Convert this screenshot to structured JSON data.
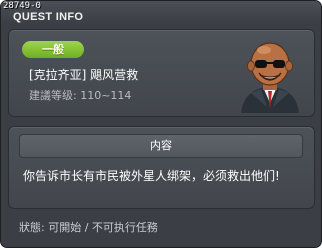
{
  "window": {
    "quest_id": "28749-0",
    "title": "QUEST INFO"
  },
  "summary": {
    "category": "一般",
    "quest_name": "[克拉齐亚] 飓风营救",
    "level_hint": "建議等级: 110~114",
    "npc_icon": "bald-sunglasses-npc-portrait"
  },
  "content": {
    "header": "内容",
    "description": "你告诉市长有市民被外星人绑架，必须救出他们!"
  },
  "footer": {
    "status": "狀態: 可開始 / 不可执行任務"
  },
  "colors": {
    "badge": "#84c336",
    "window_bg": "#3b3f45",
    "panel_bg": "#484c52"
  }
}
